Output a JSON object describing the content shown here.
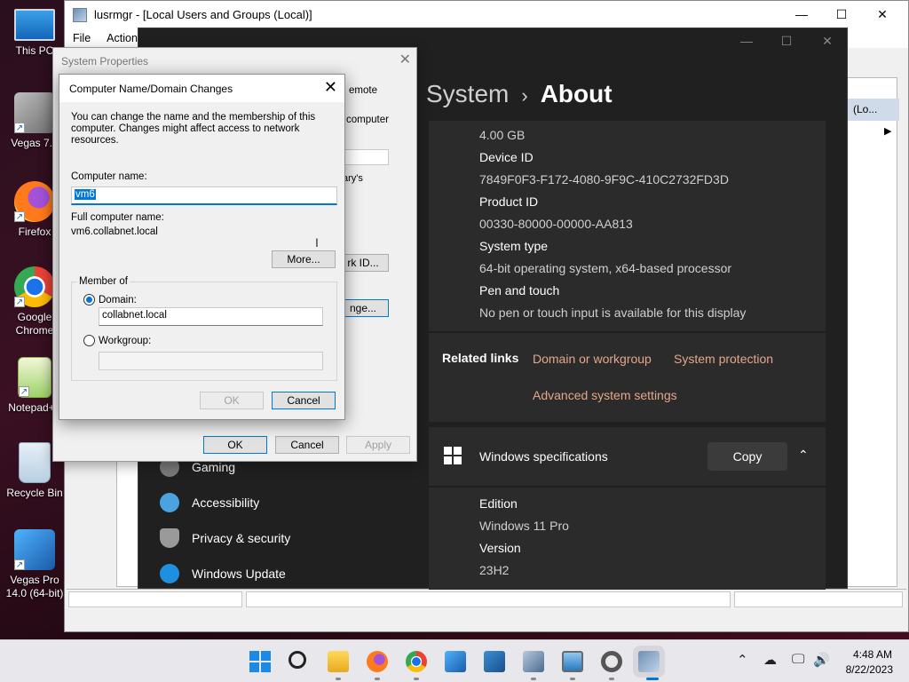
{
  "desktop": {
    "icons": [
      {
        "label": "This PC"
      },
      {
        "label": "Vegas 7.0"
      },
      {
        "label": "Firefox"
      },
      {
        "label": "Google Chrome"
      },
      {
        "label": "Notepad++"
      },
      {
        "label": "Recycle Bin"
      },
      {
        "label": "Vegas Pro 14.0 (64-bit)"
      }
    ]
  },
  "lusrmgr": {
    "title": "lusrmgr - [Local Users and Groups (Local)]",
    "menu": [
      "File",
      "Action"
    ],
    "right_pane_header": "(Lo..."
  },
  "settings": {
    "breadcrumb_parent": "System",
    "breadcrumb_current": "About",
    "specs": [
      {
        "value": "4.00 GB"
      },
      {
        "label": "Device ID",
        "value": "7849F0F3-F172-4080-9F9C-410C2732FD3D"
      },
      {
        "label": "Product ID",
        "value": "00330-80000-00000-AA813"
      },
      {
        "label": "System type",
        "value": "64-bit operating system, x64-based processor"
      },
      {
        "label": "Pen and touch",
        "value": "No pen or touch input is available for this display"
      }
    ],
    "related_links_label": "Related links",
    "related_links": [
      "Domain or workgroup",
      "System protection",
      "Advanced system settings"
    ],
    "windows_spec_title": "Windows specifications",
    "copy_label": "Copy",
    "win_specs": [
      {
        "label": "Edition",
        "value": "Windows 11 Pro"
      },
      {
        "label": "Version",
        "value": "23H2"
      }
    ],
    "nav": [
      "Gaming",
      "Accessibility",
      "Privacy & security",
      "Windows Update"
    ],
    "nav_colors": [
      "#7a7a7a",
      "#4aa3df",
      "#9a9a9a",
      "#1e90e0"
    ]
  },
  "sysprops": {
    "title": "System Properties",
    "tab_partial": "emote",
    "partial_text_1": "computer",
    "partial_text_2": "ary's",
    "network_id_button": "rk ID...",
    "change_button": "nge...",
    "ok": "OK",
    "cancel": "Cancel",
    "apply": "Apply"
  },
  "computer_name_dialog": {
    "title": "Computer Name/Domain Changes",
    "intro": "You can change the name and the membership of this computer. Changes might affect access to network resources.",
    "computer_name_label": "Computer name:",
    "computer_name_value": "vm6",
    "full_name_label": "Full computer name:",
    "full_name_value": "vm6.collabnet.local",
    "more_button": "More...",
    "member_of_label": "Member of",
    "domain_label": "Domain:",
    "domain_value": "collabnet.local",
    "workgroup_label": "Workgroup:",
    "workgroup_value": "",
    "ok": "OK",
    "cancel": "Cancel"
  },
  "taskbar": {
    "time": "4:48 AM",
    "date": "8/22/2023"
  },
  "colors": {
    "accent": "#0078d7",
    "settings_bg": "#202020",
    "link_color": "#e5a68a"
  }
}
